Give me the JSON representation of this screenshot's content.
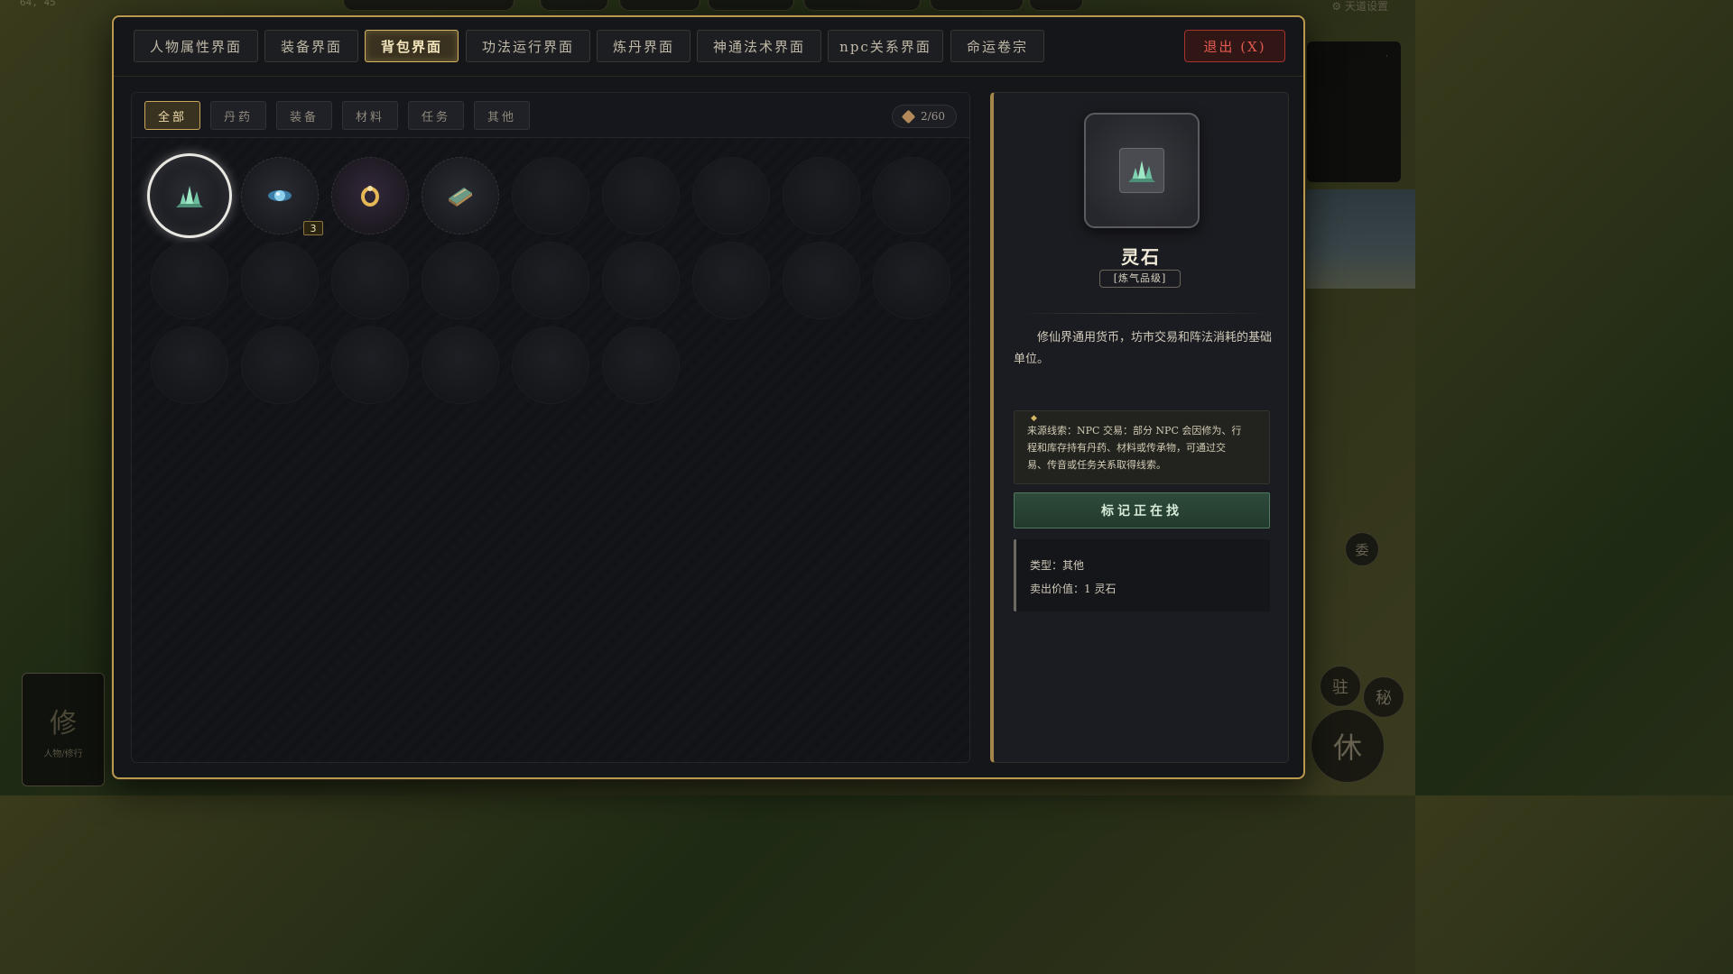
{
  "background": {
    "coords": "64, 45",
    "settings_label": "天道设置",
    "bottom_left_card": {
      "glyph": "修",
      "label": "人物/修行"
    },
    "round_buttons": [
      {
        "glyph": "驻"
      },
      {
        "glyph": "秘"
      },
      {
        "glyph": "休"
      },
      {
        "glyph": "委"
      }
    ]
  },
  "modal": {
    "tabs": [
      {
        "label": "人物属性界面"
      },
      {
        "label": "装备界面"
      },
      {
        "label": "背包界面"
      },
      {
        "label": "功法运行界面"
      },
      {
        "label": "炼丹界面"
      },
      {
        "label": "神通法术界面"
      },
      {
        "label": "npc关系界面"
      },
      {
        "label": "命运卷宗"
      }
    ],
    "active_tab": "背包界面",
    "exit_label": "退出 (X)"
  },
  "inventory": {
    "filters": [
      {
        "label": "全部"
      },
      {
        "label": "丹药"
      },
      {
        "label": "装备"
      },
      {
        "label": "材料"
      },
      {
        "label": "任务"
      },
      {
        "label": "其他"
      }
    ],
    "active_filter": "全部",
    "capacity": "2/60",
    "slots": [
      {
        "icon": "spirit-stone-icon",
        "selected": true,
        "quantity": ""
      },
      {
        "icon": "blue-orb-icon",
        "selected": false,
        "quantity": "3"
      },
      {
        "icon": "gold-ring-icon",
        "selected": false,
        "quantity": ""
      },
      {
        "icon": "scroll-book-icon",
        "selected": false,
        "quantity": ""
      }
    ],
    "empty_slot_count": 20
  },
  "detail": {
    "icon": "spirit-stone-icon",
    "name": "灵石",
    "grade": "[炼气品级]",
    "description": "修仙界通用货币，坊市交易和阵法消耗的基础单位。",
    "source_line1": "来源线索：NPC 交易：部分 NPC 会因修为、行",
    "source_line2": "程和库存持有丹药、材料或传承物，可通过交",
    "source_line3": "易、传音或任务关系取得线索。",
    "mark_button": "标记正在找",
    "type_line": "类型：其他",
    "value_line": "卖出价值：1 灵石"
  },
  "colors": {
    "accent_gold": "#d4b562",
    "exit_red": "#e25a4e",
    "mark_green": "#2e4a3a"
  }
}
